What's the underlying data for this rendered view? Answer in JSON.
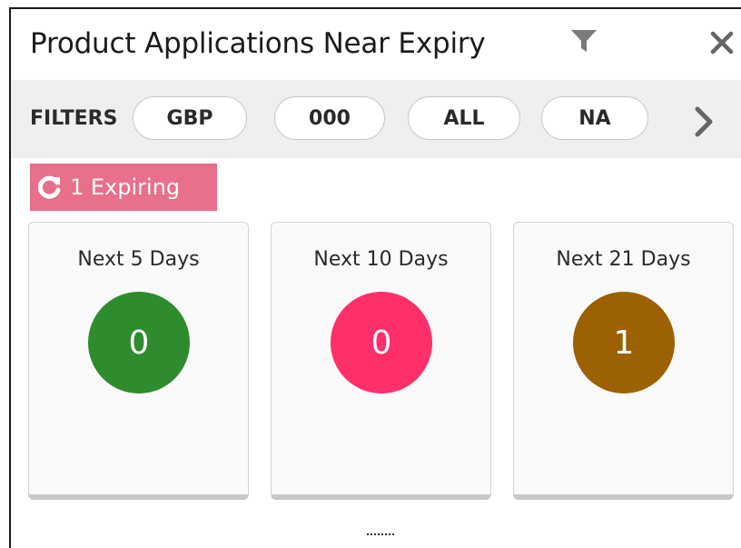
{
  "widget": {
    "title": "Product Applications Near Expiry",
    "icons": {
      "filter": "filter-icon",
      "close": "close-icon"
    }
  },
  "filters": {
    "label": "FILTERS",
    "pills": [
      "GBP",
      "000",
      "ALL",
      "NA"
    ],
    "next_icon": "chevron-right-icon"
  },
  "badge": {
    "icon": "refresh-icon",
    "text": "1 Expiring",
    "color": "#e8708b"
  },
  "cards": [
    {
      "label": "Next 5 Days",
      "count": "0",
      "color": "#2e8b2e"
    },
    {
      "label": "Next 10 Days",
      "count": "0",
      "color": "#ff2f6a"
    },
    {
      "label": "Next 21 Days",
      "count": "1",
      "color": "#9c6100"
    }
  ],
  "footer": {
    "more_icon": "more-dots-icon"
  }
}
